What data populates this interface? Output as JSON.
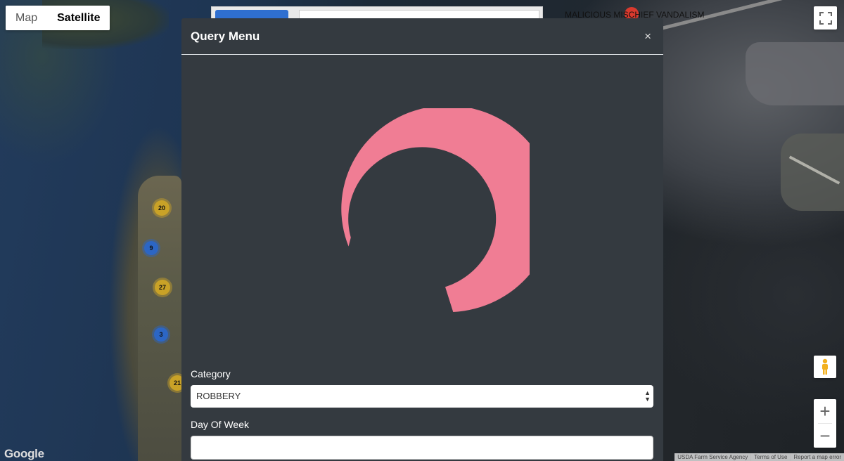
{
  "map": {
    "type_options": [
      {
        "label": "Map",
        "active": false
      },
      {
        "label": "Satellite",
        "active": true
      }
    ],
    "incident_label": "MALICIOUS MISCHIEF VANDALISM",
    "clusters": [
      {
        "count": "20",
        "color": "yellow"
      },
      {
        "count": "9",
        "color": "blue"
      },
      {
        "count": "27",
        "color": "yellow"
      },
      {
        "count": "3",
        "color": "blue"
      },
      {
        "count": "21",
        "color": "yellow"
      }
    ],
    "google_logo": "Google",
    "attribution": [
      "USDA Farm Service Agency",
      "Terms of Use",
      "Report a map error"
    ],
    "zoom_in": "+",
    "zoom_out": "−"
  },
  "modal": {
    "title": "Query Menu",
    "close_glyph": "×",
    "spinner_color": "#f07d94",
    "category": {
      "label": "Category",
      "value": "ROBBERY"
    },
    "day_of_week": {
      "label": "Day Of Week",
      "value": ""
    }
  }
}
